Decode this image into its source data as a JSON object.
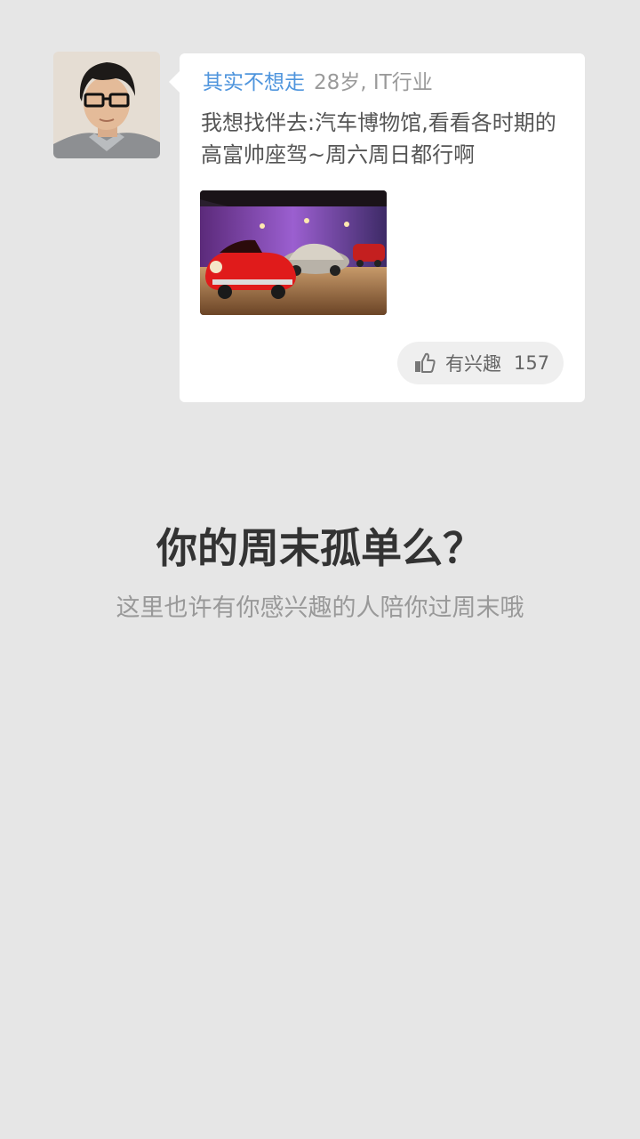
{
  "post": {
    "author_name": "其实不想走",
    "author_info": "28岁, IT行业",
    "text": "我想找伴去:汽车博物馆,看看各时期的高富帅座驾~周六周日都行啊",
    "interest_label": "有兴趣",
    "interest_count": "157"
  },
  "promo": {
    "headline": "你的周末孤单么？",
    "subline": "这里也许有你感兴趣的人陪你过周末哦"
  },
  "icons": {
    "like": "thumbs-up-icon"
  },
  "colors": {
    "background": "#e6e6e6",
    "card": "#ffffff",
    "author_name": "#4f95dd",
    "meta_gray": "#9a9a9a",
    "headline": "#333333",
    "subline": "#999999"
  }
}
